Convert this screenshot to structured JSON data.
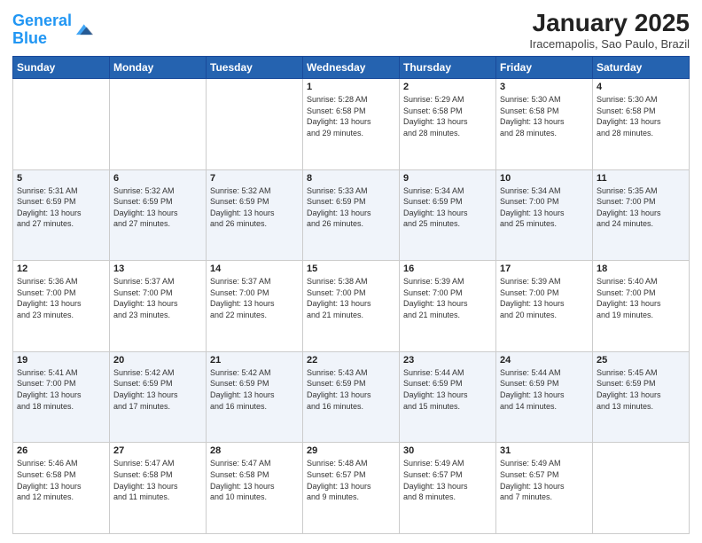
{
  "logo": {
    "line1": "General",
    "line2": "Blue"
  },
  "title": "January 2025",
  "location": "Iracemapolis, Sao Paulo, Brazil",
  "weekdays": [
    "Sunday",
    "Monday",
    "Tuesday",
    "Wednesday",
    "Thursday",
    "Friday",
    "Saturday"
  ],
  "weeks": [
    [
      {
        "day": "",
        "info": ""
      },
      {
        "day": "",
        "info": ""
      },
      {
        "day": "",
        "info": ""
      },
      {
        "day": "1",
        "info": "Sunrise: 5:28 AM\nSunset: 6:58 PM\nDaylight: 13 hours\nand 29 minutes."
      },
      {
        "day": "2",
        "info": "Sunrise: 5:29 AM\nSunset: 6:58 PM\nDaylight: 13 hours\nand 28 minutes."
      },
      {
        "day": "3",
        "info": "Sunrise: 5:30 AM\nSunset: 6:58 PM\nDaylight: 13 hours\nand 28 minutes."
      },
      {
        "day": "4",
        "info": "Sunrise: 5:30 AM\nSunset: 6:58 PM\nDaylight: 13 hours\nand 28 minutes."
      }
    ],
    [
      {
        "day": "5",
        "info": "Sunrise: 5:31 AM\nSunset: 6:59 PM\nDaylight: 13 hours\nand 27 minutes."
      },
      {
        "day": "6",
        "info": "Sunrise: 5:32 AM\nSunset: 6:59 PM\nDaylight: 13 hours\nand 27 minutes."
      },
      {
        "day": "7",
        "info": "Sunrise: 5:32 AM\nSunset: 6:59 PM\nDaylight: 13 hours\nand 26 minutes."
      },
      {
        "day": "8",
        "info": "Sunrise: 5:33 AM\nSunset: 6:59 PM\nDaylight: 13 hours\nand 26 minutes."
      },
      {
        "day": "9",
        "info": "Sunrise: 5:34 AM\nSunset: 6:59 PM\nDaylight: 13 hours\nand 25 minutes."
      },
      {
        "day": "10",
        "info": "Sunrise: 5:34 AM\nSunset: 7:00 PM\nDaylight: 13 hours\nand 25 minutes."
      },
      {
        "day": "11",
        "info": "Sunrise: 5:35 AM\nSunset: 7:00 PM\nDaylight: 13 hours\nand 24 minutes."
      }
    ],
    [
      {
        "day": "12",
        "info": "Sunrise: 5:36 AM\nSunset: 7:00 PM\nDaylight: 13 hours\nand 23 minutes."
      },
      {
        "day": "13",
        "info": "Sunrise: 5:37 AM\nSunset: 7:00 PM\nDaylight: 13 hours\nand 23 minutes."
      },
      {
        "day": "14",
        "info": "Sunrise: 5:37 AM\nSunset: 7:00 PM\nDaylight: 13 hours\nand 22 minutes."
      },
      {
        "day": "15",
        "info": "Sunrise: 5:38 AM\nSunset: 7:00 PM\nDaylight: 13 hours\nand 21 minutes."
      },
      {
        "day": "16",
        "info": "Sunrise: 5:39 AM\nSunset: 7:00 PM\nDaylight: 13 hours\nand 21 minutes."
      },
      {
        "day": "17",
        "info": "Sunrise: 5:39 AM\nSunset: 7:00 PM\nDaylight: 13 hours\nand 20 minutes."
      },
      {
        "day": "18",
        "info": "Sunrise: 5:40 AM\nSunset: 7:00 PM\nDaylight: 13 hours\nand 19 minutes."
      }
    ],
    [
      {
        "day": "19",
        "info": "Sunrise: 5:41 AM\nSunset: 7:00 PM\nDaylight: 13 hours\nand 18 minutes."
      },
      {
        "day": "20",
        "info": "Sunrise: 5:42 AM\nSunset: 6:59 PM\nDaylight: 13 hours\nand 17 minutes."
      },
      {
        "day": "21",
        "info": "Sunrise: 5:42 AM\nSunset: 6:59 PM\nDaylight: 13 hours\nand 16 minutes."
      },
      {
        "day": "22",
        "info": "Sunrise: 5:43 AM\nSunset: 6:59 PM\nDaylight: 13 hours\nand 16 minutes."
      },
      {
        "day": "23",
        "info": "Sunrise: 5:44 AM\nSunset: 6:59 PM\nDaylight: 13 hours\nand 15 minutes."
      },
      {
        "day": "24",
        "info": "Sunrise: 5:44 AM\nSunset: 6:59 PM\nDaylight: 13 hours\nand 14 minutes."
      },
      {
        "day": "25",
        "info": "Sunrise: 5:45 AM\nSunset: 6:59 PM\nDaylight: 13 hours\nand 13 minutes."
      }
    ],
    [
      {
        "day": "26",
        "info": "Sunrise: 5:46 AM\nSunset: 6:58 PM\nDaylight: 13 hours\nand 12 minutes."
      },
      {
        "day": "27",
        "info": "Sunrise: 5:47 AM\nSunset: 6:58 PM\nDaylight: 13 hours\nand 11 minutes."
      },
      {
        "day": "28",
        "info": "Sunrise: 5:47 AM\nSunset: 6:58 PM\nDaylight: 13 hours\nand 10 minutes."
      },
      {
        "day": "29",
        "info": "Sunrise: 5:48 AM\nSunset: 6:57 PM\nDaylight: 13 hours\nand 9 minutes."
      },
      {
        "day": "30",
        "info": "Sunrise: 5:49 AM\nSunset: 6:57 PM\nDaylight: 13 hours\nand 8 minutes."
      },
      {
        "day": "31",
        "info": "Sunrise: 5:49 AM\nSunset: 6:57 PM\nDaylight: 13 hours\nand 7 minutes."
      },
      {
        "day": "",
        "info": ""
      }
    ]
  ]
}
